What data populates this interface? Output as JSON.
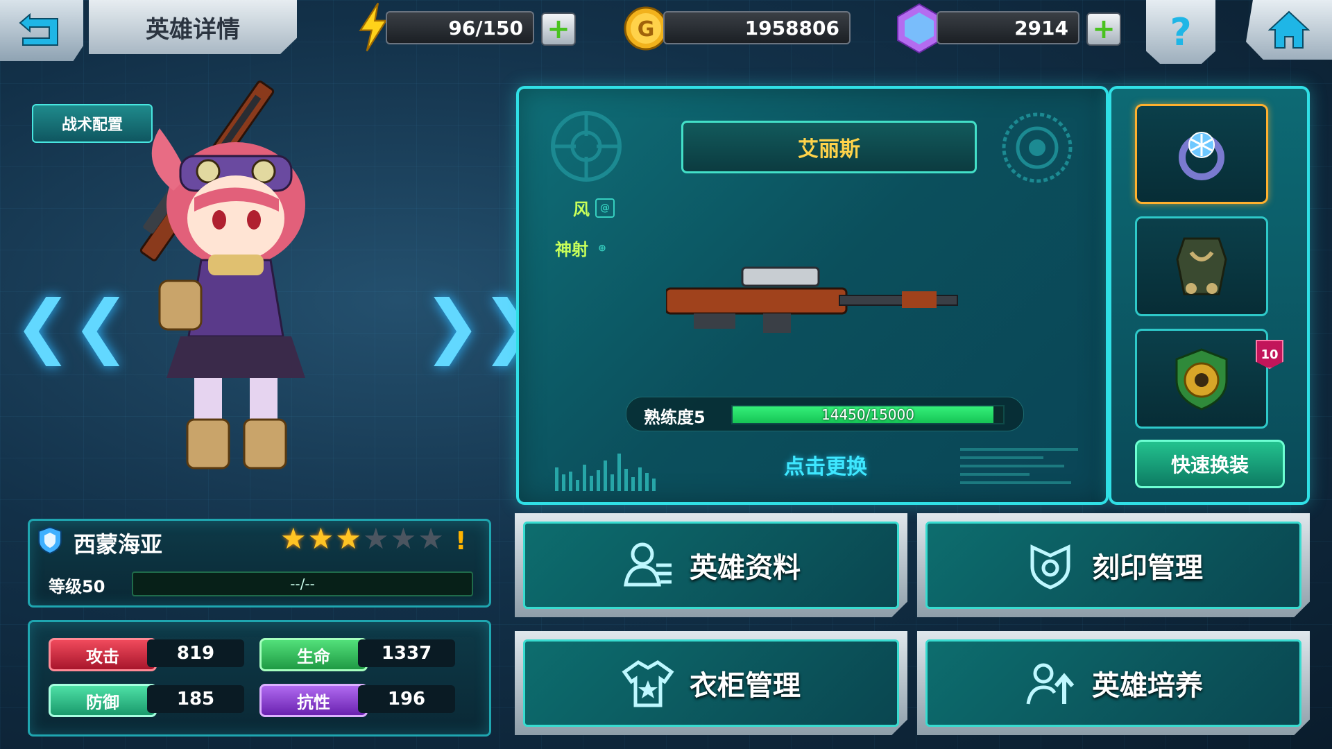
{
  "header": {
    "title": "英雄详情",
    "energy": "96/150",
    "gold": "1958806",
    "gems": "2914",
    "help_label": "?"
  },
  "hero": {
    "tactic_tab": "战术配置",
    "name": "西蒙海亚",
    "stars_filled": 3,
    "stars_total": 6,
    "level": "等级50",
    "xp": "--/--",
    "stats": {
      "attack_label": "攻击",
      "attack": "819",
      "hp_label": "生命",
      "hp": "1337",
      "defense_label": "防御",
      "defense": "185",
      "resist_label": "抗性",
      "resist": "196"
    }
  },
  "weapon": {
    "name": "艾丽斯",
    "element": "风",
    "trait": "神射",
    "proficiency_label": "熟练度5",
    "proficiency_text": "14450/15000",
    "proficiency_value": 14450,
    "proficiency_max": 15000,
    "change_label": "点击更换"
  },
  "equipment": {
    "slot3_badge": "10",
    "quick_label": "快速换装"
  },
  "menu": {
    "hero_info": "英雄资料",
    "imprint": "刻印管理",
    "wardrobe": "衣柜管理",
    "training": "英雄培养"
  },
  "colors": {
    "accent": "#30e0e6",
    "attack": "#d8283e",
    "hp": "#2dbf55",
    "defense": "#2fbf86",
    "resist": "#8a3ad6"
  }
}
